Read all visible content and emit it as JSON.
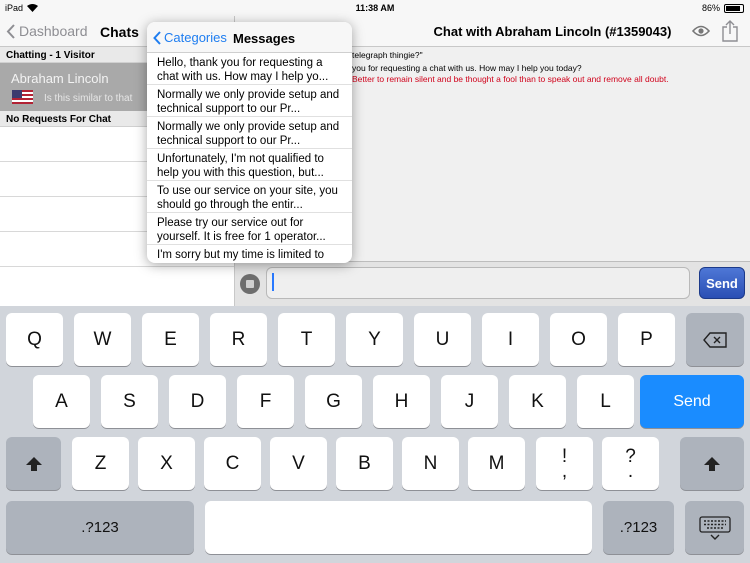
{
  "status_bar": {
    "device": "iPad",
    "time": "11:38 AM",
    "battery_text": "86%",
    "battery_level": 0.86
  },
  "left_nav": {
    "back_label": "Dashboard",
    "title": "Chats"
  },
  "chat_list": {
    "section_title": "Chatting - 1 Visitor",
    "visitor_name": "Abraham Lincoln",
    "visitor_preview": "Is this similar to that",
    "requests_title": "No Requests For Chat"
  },
  "right_nav": {
    "title": "Chat with Abraham Lincoln (#1359043)"
  },
  "transcript": {
    "line1": "telegraph thingie?\"",
    "line2": "you for requesting a chat with us. How may I help you today?",
    "line3": "Better to remain silent and be thought a fool than to speak out and remove all doubt."
  },
  "composer": {
    "value": "",
    "send_label": "Send"
  },
  "popover": {
    "back_label": "Categories",
    "title": "Messages",
    "messages": [
      "Hello, thank you for requesting a chat with us. How may I help yo...",
      "Normally we only provide setup and technical support to our Pr...",
      "Normally we only provide setup and technical support to our Pr...",
      "Unfortunately, I'm not qualified to help you with this question, but...",
      "To use our service on your site, you should go through the entir...",
      "Please try our service out for yourself. It is free for 1 operator...",
      "I'm sorry but my time is limited to"
    ]
  },
  "keyboard": {
    "row1": [
      "Q",
      "W",
      "E",
      "R",
      "T",
      "Y",
      "U",
      "I",
      "O",
      "P"
    ],
    "row2": [
      "A",
      "S",
      "D",
      "F",
      "G",
      "H",
      "J",
      "K",
      "L"
    ],
    "row2_return": "Send",
    "row3": [
      "Z",
      "X",
      "C",
      "V",
      "B",
      "N",
      "M"
    ],
    "row3_punct1_top": "!",
    "row3_punct1_bottom": ",",
    "row3_punct2_top": "?",
    "row3_punct2_bottom": ".",
    "numbers_label": ".?123"
  },
  "icons": {
    "back": "chevron-left-icon",
    "wifi": "wifi-icon",
    "eye": "eye-icon",
    "share": "share-icon",
    "attach": "attach-icon",
    "backspace": "backspace-icon",
    "shift": "shift-icon",
    "hide_keyboard": "keyboard-hide-icon"
  },
  "colors": {
    "accent": "#1e7df0",
    "send_blue": "#1a8cff",
    "alert_text": "#d0021b"
  }
}
